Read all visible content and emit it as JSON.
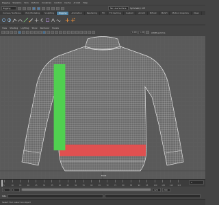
{
  "menu": {
    "items": [
      "Rigging",
      "Skeleton",
      "Skin",
      "Deform",
      "Constrain",
      "Control",
      "Cache",
      "Arnold",
      "Help"
    ]
  },
  "status": {
    "mode": "Rigging",
    "no_live_surface": "No Live Surface",
    "symmetry": "Symmetry: Off"
  },
  "shelf": {
    "tabs": [
      "Curves / Surfaces",
      "Poly Modeling",
      "Sculpting",
      "Rigging",
      "Animation",
      "Rendering",
      "FX",
      "FX Caching",
      "Custom",
      "Arnold",
      "Bifrost",
      "MASH",
      "Motion Graphics",
      "XGen"
    ],
    "active_index": 3
  },
  "panel_menu": {
    "items": [
      "View",
      "Shading",
      "Lighting",
      "Show",
      "Renderer",
      "Panels"
    ]
  },
  "panel_toolbar": {
    "value1": "0.00",
    "value2": "1.00",
    "color_space": "sRGB gamma"
  },
  "viewport": {
    "camera": "front",
    "background_color": "#5a5a5a",
    "wire_color": "#d6d6d6"
  },
  "timeline": {
    "tick_labels": [
      "5",
      "10",
      "15",
      "20",
      "25",
      "30",
      "35",
      "40",
      "45",
      "50",
      "55",
      "60",
      "65",
      "70",
      "75",
      "80",
      "85",
      "90",
      "95",
      "100",
      "105",
      "110",
      "115"
    ],
    "current_frame": "1"
  },
  "range": {
    "start": "1",
    "start_inner": "1",
    "end_inner": "120",
    "end": "200"
  },
  "command": {
    "lang": "MEL"
  },
  "help_line": "Select Tool: select an object"
}
